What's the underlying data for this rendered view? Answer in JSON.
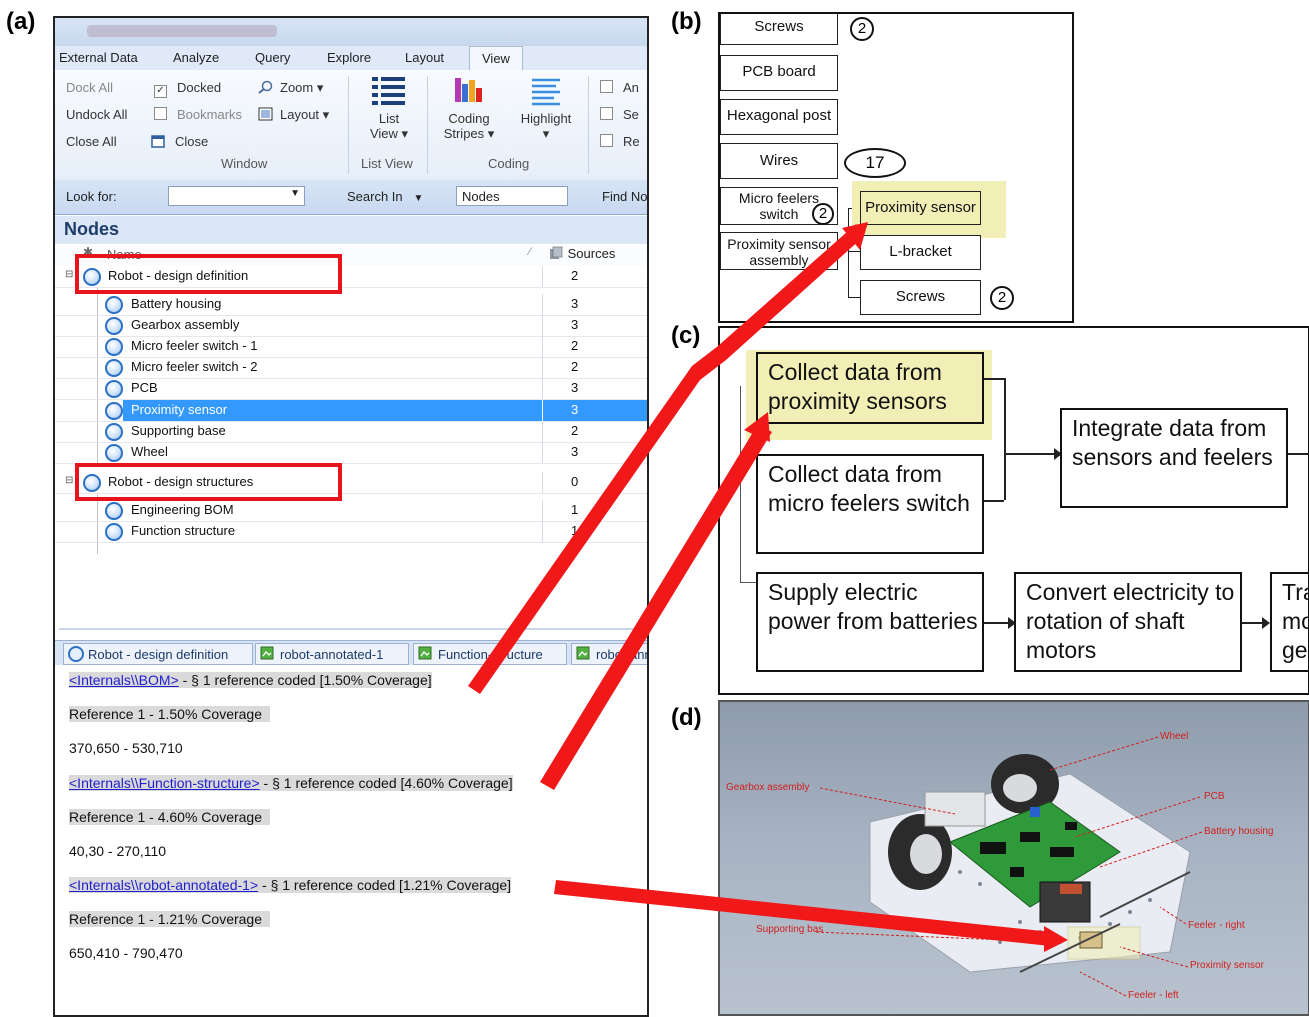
{
  "panel_labels": {
    "a": "(a)",
    "b": "(b)",
    "c": "(c)",
    "d": "(d)"
  },
  "ribbon": {
    "tabs": [
      "External Data",
      "Analyze",
      "Query",
      "Explore",
      "Layout",
      "View"
    ],
    "active_tab": "View",
    "window_group": {
      "dock_all": "Dock All",
      "undock_all": "Undock All",
      "close_all": "Close All",
      "docked": "Docked",
      "bookmarks": "Bookmarks",
      "close": "Close",
      "zoom": "Zoom",
      "layout": "Layout",
      "label": "Window"
    },
    "list_view_group": {
      "button_line1": "List",
      "button_line2": "View",
      "label": "List View"
    },
    "coding_group": {
      "stripes_line1": "Coding",
      "stripes_line2": "Stripes",
      "highlight": "Highlight",
      "label": "Coding"
    },
    "cut_items": [
      "An",
      "Se",
      "Re"
    ]
  },
  "findbar": {
    "look_for": "Look for:",
    "search_in": "Search In",
    "scope": "Nodes",
    "find_now": "Find No"
  },
  "nodes": {
    "title": "Nodes",
    "col_name": "Name",
    "col_sources": "Sources",
    "groups": [
      {
        "name": "Robot - design definition",
        "sources": "2",
        "children": [
          {
            "name": "Battery housing",
            "sources": "3"
          },
          {
            "name": "Gearbox assembly",
            "sources": "3"
          },
          {
            "name": "Micro feeler switch - 1",
            "sources": "2"
          },
          {
            "name": "Micro feeler switch - 2",
            "sources": "2"
          },
          {
            "name": "PCB",
            "sources": "3"
          },
          {
            "name": "Proximity sensor",
            "sources": "3",
            "selected": true
          },
          {
            "name": "Supporting base",
            "sources": "2"
          },
          {
            "name": "Wheel",
            "sources": "3"
          }
        ]
      },
      {
        "name": "Robot - design structures",
        "sources": "0",
        "children": [
          {
            "name": "Engineering BOM",
            "sources": "1"
          },
          {
            "name": "Function structure",
            "sources": "1"
          }
        ]
      }
    ]
  },
  "doc_tabs": [
    "Robot - design definition",
    "robot-annotated-1",
    "Function-structure",
    "robot-annotated"
  ],
  "references": [
    {
      "link": "<Internals\\\\BOM>",
      "summary": " - § 1 reference coded  [1.50% Coverage]",
      "ref": "Reference 1 - 1.50% Coverage",
      "coords": "370,650 - 530,710"
    },
    {
      "link": "<Internals\\\\Function-structure>",
      "summary": " - § 1 reference coded  [4.60% Coverage]",
      "ref": "Reference 1 - 4.60% Coverage",
      "coords": "40,30 - 270,110"
    },
    {
      "link": "<Internals\\\\robot-annotated-1>",
      "summary": " - § 1 reference coded  [1.21% Coverage]",
      "ref": "Reference 1 - 1.21% Coverage",
      "coords": "650,410 - 790,470"
    }
  ],
  "bom": {
    "items": [
      "Screws",
      "PCB board",
      "Hexagonal post",
      "Wires",
      "Micro feelers switch",
      "Proximity sensor assembly"
    ],
    "sub_items": [
      "Proximity sensor",
      "L-bracket",
      "Screws"
    ],
    "qty_screws": "2",
    "qty_wires": "17",
    "qty_micro": "2",
    "qty_sub_screws": "2"
  },
  "function_structure": {
    "collect_proximity": "Collect data from proximity sensors",
    "collect_micro": "Collect data from micro feelers switch",
    "integrate": "Integrate data from sensors and feelers",
    "supply": "Supply electric power from batteries",
    "convert": "Convert electricity to rotation of shaft motors",
    "cut_box": "Tra mo ge"
  },
  "robot_labels": {
    "wheel": "Wheel",
    "gearbox": "Gearbox assembly",
    "pcb": "PCB",
    "battery": "Battery housing",
    "feeler_right": "Feeler - right",
    "supporting": "Supporting bas",
    "proximity": "Proximity sensor",
    "feeler_left": "Feeler - left"
  },
  "colors": {
    "highlight_red": "#e8141b",
    "arrow_red": "#f01818",
    "selected_blue": "#3399ff",
    "sensor_yellow": "#f2efb6"
  }
}
